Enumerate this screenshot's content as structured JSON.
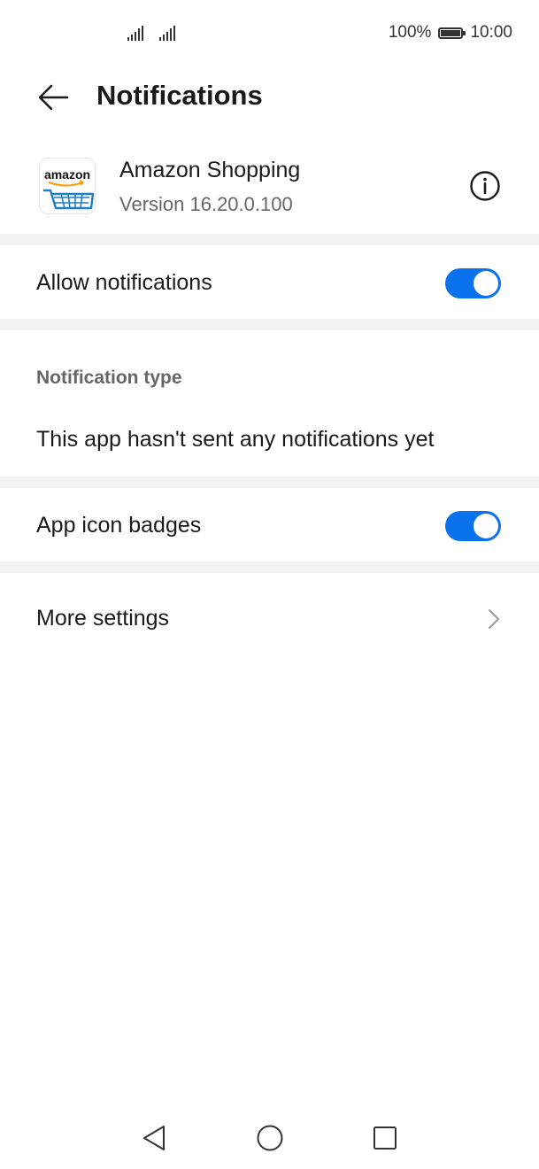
{
  "status_bar": {
    "battery_percent": "100%",
    "time": "10:00",
    "icons": [
      "signal-icon",
      "signal-icon",
      "battery-icon"
    ]
  },
  "header": {
    "title": "Notifications",
    "back_icon": "arrow-left-icon"
  },
  "app": {
    "logo_text": "amazon",
    "name": "Amazon Shopping",
    "version": "Version 16.20.0.100",
    "info_icon": "info-icon"
  },
  "settings": {
    "allow_notifications": {
      "label": "Allow notifications",
      "enabled": true
    },
    "notification_type": {
      "section_label": "Notification type",
      "empty_message": "This app hasn't sent any notifications yet"
    },
    "app_icon_badges": {
      "label": "App icon badges",
      "enabled": true
    },
    "more_settings": {
      "label": "More settings",
      "icon": "chevron-right-icon"
    }
  },
  "colors": {
    "accent": "#0a72ec",
    "divider": "#f3f3f3",
    "secondary_text": "#666666"
  },
  "nav_bar": {
    "icons": [
      "triangle-back-icon",
      "circle-home-icon",
      "square-recents-icon"
    ]
  }
}
